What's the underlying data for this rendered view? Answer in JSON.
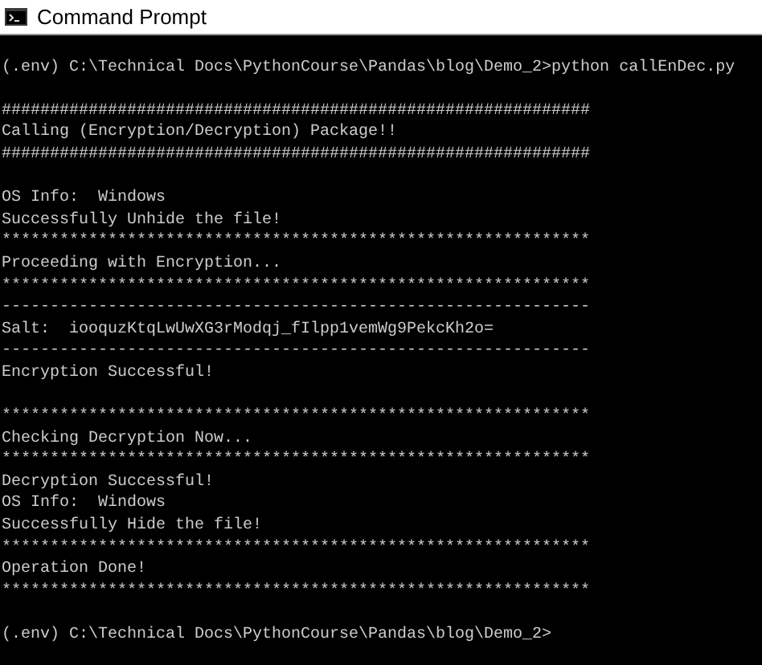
{
  "window": {
    "title": "Command Prompt"
  },
  "console": {
    "lines": [
      {
        "kind": "blank"
      },
      {
        "kind": "text",
        "text": "(.env) C:\\Technical Docs\\PythonCourse\\Pandas\\blog\\Demo_2>python callEnDec.py"
      },
      {
        "kind": "blank"
      },
      {
        "kind": "text",
        "text": "#############################################################"
      },
      {
        "kind": "text",
        "text": "Calling (Encryption/Decryption) Package!!"
      },
      {
        "kind": "text",
        "text": "#############################################################"
      },
      {
        "kind": "blank"
      },
      {
        "kind": "text",
        "text": "OS Info:  Windows"
      },
      {
        "kind": "text",
        "text": "Successfully Unhide the file!"
      },
      {
        "kind": "text",
        "text": "*************************************************************"
      },
      {
        "kind": "text",
        "text": "Proceeding with Encryption..."
      },
      {
        "kind": "text",
        "text": "*************************************************************"
      },
      {
        "kind": "text",
        "text": "-------------------------------------------------------------"
      },
      {
        "kind": "text",
        "text": "Salt:  iooquzKtqLwUwXG3rModqj_fIlpp1vemWg9PekcKh2o="
      },
      {
        "kind": "text",
        "text": "-------------------------------------------------------------"
      },
      {
        "kind": "text",
        "text": "Encryption Successful!"
      },
      {
        "kind": "blank"
      },
      {
        "kind": "text",
        "text": "*************************************************************"
      },
      {
        "kind": "text",
        "text": "Checking Decryption Now..."
      },
      {
        "kind": "text",
        "text": "*************************************************************"
      },
      {
        "kind": "text",
        "text": "Decryption Successful!"
      },
      {
        "kind": "text",
        "text": "OS Info:  Windows"
      },
      {
        "kind": "text",
        "text": "Successfully Hide the file!"
      },
      {
        "kind": "text",
        "text": "*************************************************************"
      },
      {
        "kind": "text",
        "text": "Operation Done!"
      },
      {
        "kind": "text",
        "text": "*************************************************************"
      },
      {
        "kind": "blank"
      },
      {
        "kind": "text",
        "text": "(.env) C:\\Technical Docs\\PythonCourse\\Pandas\\blog\\Demo_2>"
      }
    ]
  }
}
